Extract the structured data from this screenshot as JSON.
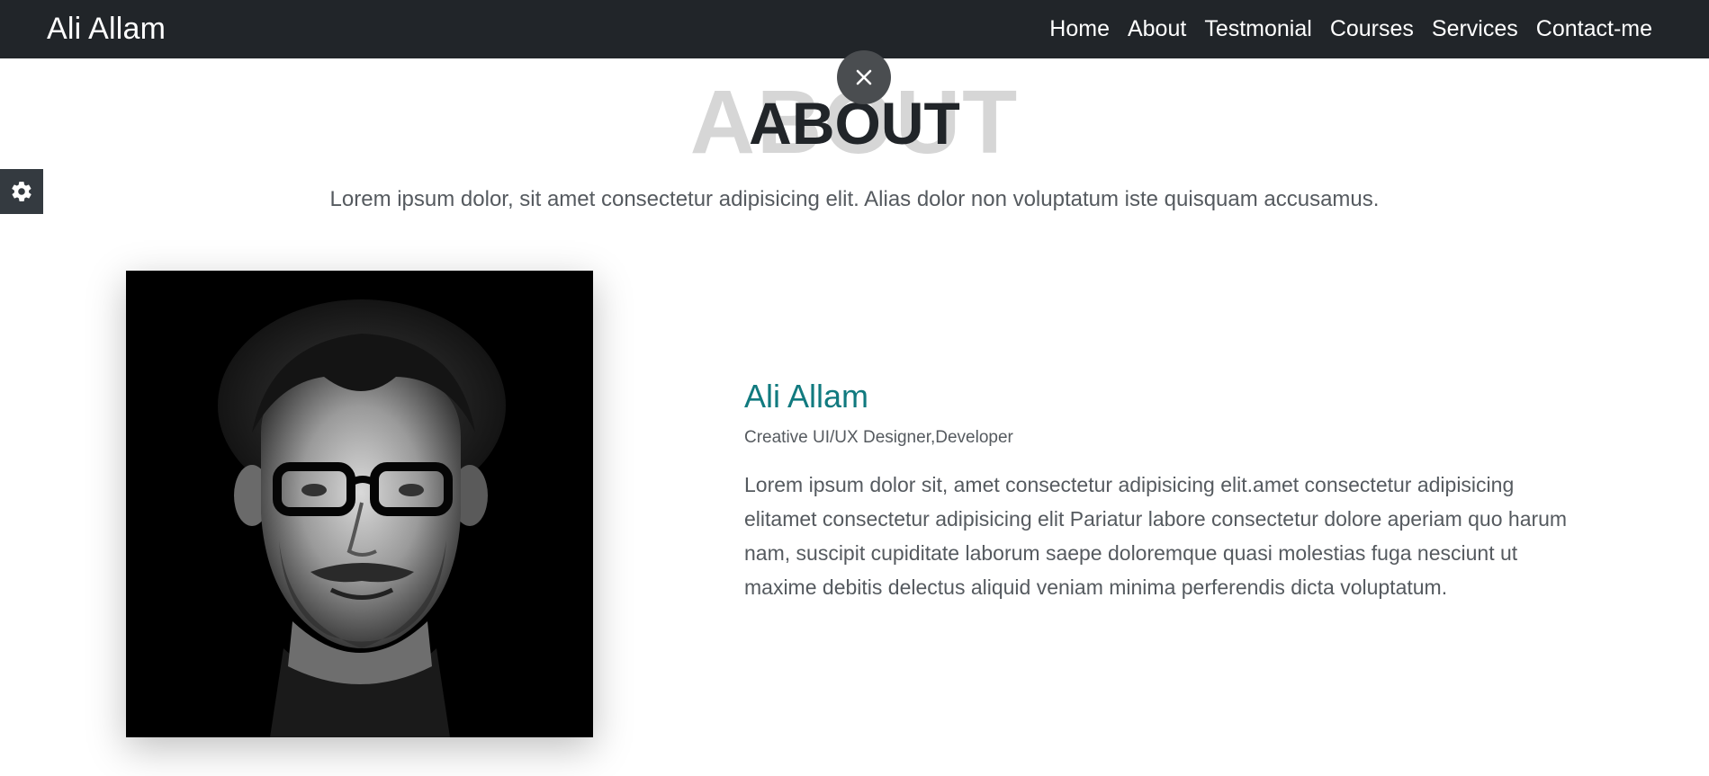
{
  "navbar": {
    "brand": "Ali Allam",
    "links": [
      "Home",
      "About",
      "Testmonial",
      "Courses",
      "Services",
      "Contact-me"
    ]
  },
  "controls": {
    "close_icon": "close-icon",
    "settings_icon": "gear-icon"
  },
  "about": {
    "heading_bg": "ABOUT",
    "heading": "ABOUT",
    "subtitle": "Lorem ipsum dolor, sit amet consectetur adipisicing elit. Alias dolor non voluptatum iste quisquam accusamus.",
    "name": "Ali Allam",
    "role": "Creative UI/UX Designer,Developer",
    "description": "Lorem ipsum dolor sit, amet consectetur adipisicing elit.amet consectetur adipisicing elitamet consectetur adipisicing elit Pariatur labore consectetur dolore aperiam quo harum nam, suscipit cupiditate laborum saepe doloremque quasi molestias fuga nesciunt ut maxime debitis delectus aliquid veniam minima perferendis dicta voluptatum."
  },
  "colors": {
    "navbar_bg": "#212529",
    "accent": "#117a7f",
    "text_muted": "#555a5f"
  }
}
